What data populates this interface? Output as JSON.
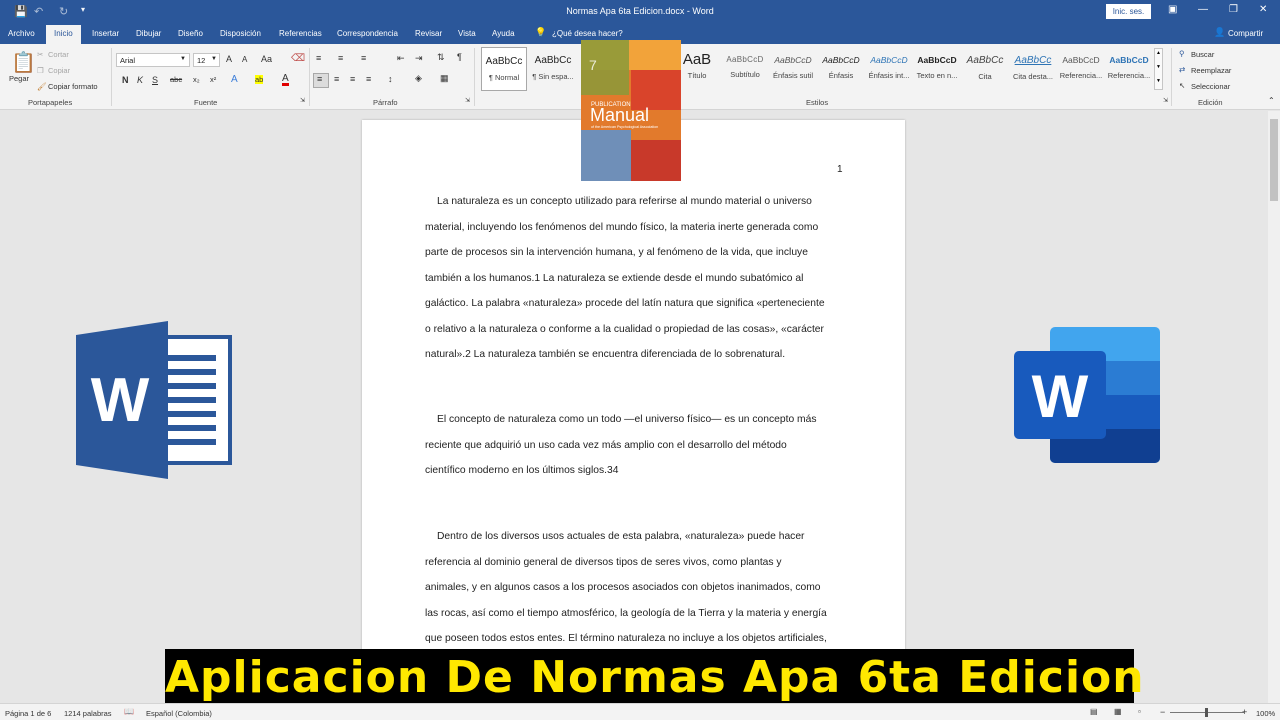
{
  "window": {
    "title": "Normas Apa 6ta Edicion.docx - Word",
    "sign_in": "Inic. ses.",
    "share": "Compartir"
  },
  "tabs": [
    "Archivo",
    "Inicio",
    "Insertar",
    "Dibujar",
    "Diseño",
    "Disposición",
    "Referencias",
    "Correspondencia",
    "Revisar",
    "Vista",
    "Ayuda"
  ],
  "tell_me": "¿Qué desea hacer?",
  "clipboard": {
    "paste": "Pegar",
    "cut": "Cortar",
    "copy": "Copiar",
    "format_painter": "Copiar formato",
    "group": "Portapapeles"
  },
  "font": {
    "name": "Arial",
    "size": "12",
    "group": "Fuente",
    "bold": "N",
    "italic": "K",
    "underline": "S",
    "grow": "A",
    "shrink": "A",
    "change_case": "Aa",
    "strike": "abc",
    "sub": "x₂",
    "sup": "x²",
    "effects": "A",
    "highlight": "ab",
    "color": "A"
  },
  "paragraph": {
    "group": "Párrafo"
  },
  "styles": {
    "group": "Estilos",
    "items": [
      {
        "preview": "AaBbCc",
        "name": "¶ Normal"
      },
      {
        "preview": "AaBbCc",
        "name": "¶ Sin espa..."
      },
      {
        "preview": "AaB",
        "name": "Título"
      },
      {
        "preview": "AaBbCcD",
        "name": "Subtítulo"
      },
      {
        "preview": "AaBbCcD",
        "name": "Énfasis sutil"
      },
      {
        "preview": "AaBbCcD",
        "name": "Énfasis"
      },
      {
        "preview": "AaBbCcD",
        "name": "Énfasis int..."
      },
      {
        "preview": "AaBbCcD",
        "name": "Texto en n..."
      },
      {
        "preview": "AaBbCc",
        "name": "Cita"
      },
      {
        "preview": "AaBbCc",
        "name": "Cita desta..."
      },
      {
        "preview": "AaBbCcD",
        "name": "Referencia..."
      },
      {
        "preview": "AaBbCcD",
        "name": "Referencia..."
      }
    ]
  },
  "editing": {
    "group": "Edición",
    "find": "Buscar",
    "replace": "Reemplazar",
    "select": "Seleccionar"
  },
  "document": {
    "page_number": "1",
    "paragraphs": [
      [
        "La naturaleza es un concepto utilizado para referirse al mundo material o universo",
        "material, incluyendo los fenómenos del mundo físico, la materia inerte generada como",
        "parte de procesos sin la intervención humana, y al fenómeno de la vida, que incluye",
        "también a los humanos.1 La naturaleza se extiende desde el mundo subatómico al",
        "galáctico. La palabra «naturaleza» procede del latín natura que significa «perteneciente",
        "o relativo a la naturaleza o conforme a la cualidad o propiedad de las cosas», «carácter",
        "natural».2 La naturaleza también se encuentra diferenciada de lo sobrenatural."
      ],
      [
        "El concepto de naturaleza como un todo —el universo físico— es un concepto más",
        "reciente que adquirió un uso cada vez más amplio con el desarrollo del método",
        "científico moderno en los últimos siglos.34"
      ],
      [
        "Dentro de los diversos usos actuales de esta palabra, «naturaleza» puede hacer",
        "referencia al dominio general de diversos tipos de seres vivos, como plantas y",
        "animales, y en algunos casos a los procesos asociados con objetos inanimados, como",
        "las rocas, así como el tiempo atmosférico, la geología de la Tierra y la materia y energía",
        "que poseen todos estos entes. El término naturaleza no incluye a los objetos artificiales,"
      ]
    ]
  },
  "book": {
    "line1": "PUBLICATION",
    "line2": "Manual",
    "line3": "of the American Psychological Association",
    "edition": "7"
  },
  "logo_left": "W",
  "logo_right": "W",
  "banner": "Aplicacion De Normas Apa 6ta Edicion",
  "status": {
    "page": "Página 1 de 6",
    "words": "1214 palabras",
    "language": "Español (Colombia)",
    "zoom": "100%"
  },
  "colors": {
    "word_blue": "#2b579a",
    "banner_text": "#ffe800",
    "banner_bg": "#000000"
  }
}
